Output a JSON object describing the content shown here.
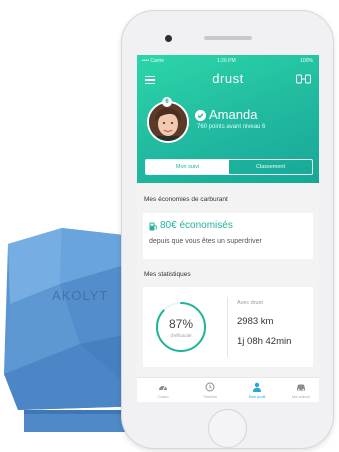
{
  "device": {
    "label": "AKOLYT"
  },
  "status_bar": {
    "carrier": "•••• Carrie",
    "time": "1:26 PM",
    "battery": "100%"
  },
  "app": {
    "title": "drust"
  },
  "profile": {
    "level": "6",
    "name": "Amanda",
    "subtitle": "760 points avant niveau 6"
  },
  "tabs": [
    {
      "label": "Mon suivi",
      "active": true
    },
    {
      "label": "Classement",
      "active": false
    }
  ],
  "fuel_savings": {
    "section_title": "Mes économies de carburant",
    "amount": "80€ économisés",
    "description": "depuis que vous êtes un superdriver"
  },
  "statistics": {
    "section_title": "Mes statistiques",
    "efficiency_value": "87%",
    "efficiency_fraction": 0.87,
    "efficiency_label": "d'efficacité",
    "heading": "Avec drust",
    "distance": "2983 km",
    "duration": "1j 08h 42min"
  },
  "bottom_nav": [
    {
      "label": "Coach",
      "icon": "gauge-icon",
      "active": false
    },
    {
      "label": "Timeline",
      "icon": "history-icon",
      "active": false
    },
    {
      "label": "Mon profil",
      "icon": "person-icon",
      "active": true
    },
    {
      "label": "Ma voiture",
      "icon": "car-icon",
      "active": false
    }
  ],
  "colors": {
    "accent": "#22b6a0",
    "device_blue": "#5b95d1",
    "nav_active": "#2aa6d8"
  }
}
